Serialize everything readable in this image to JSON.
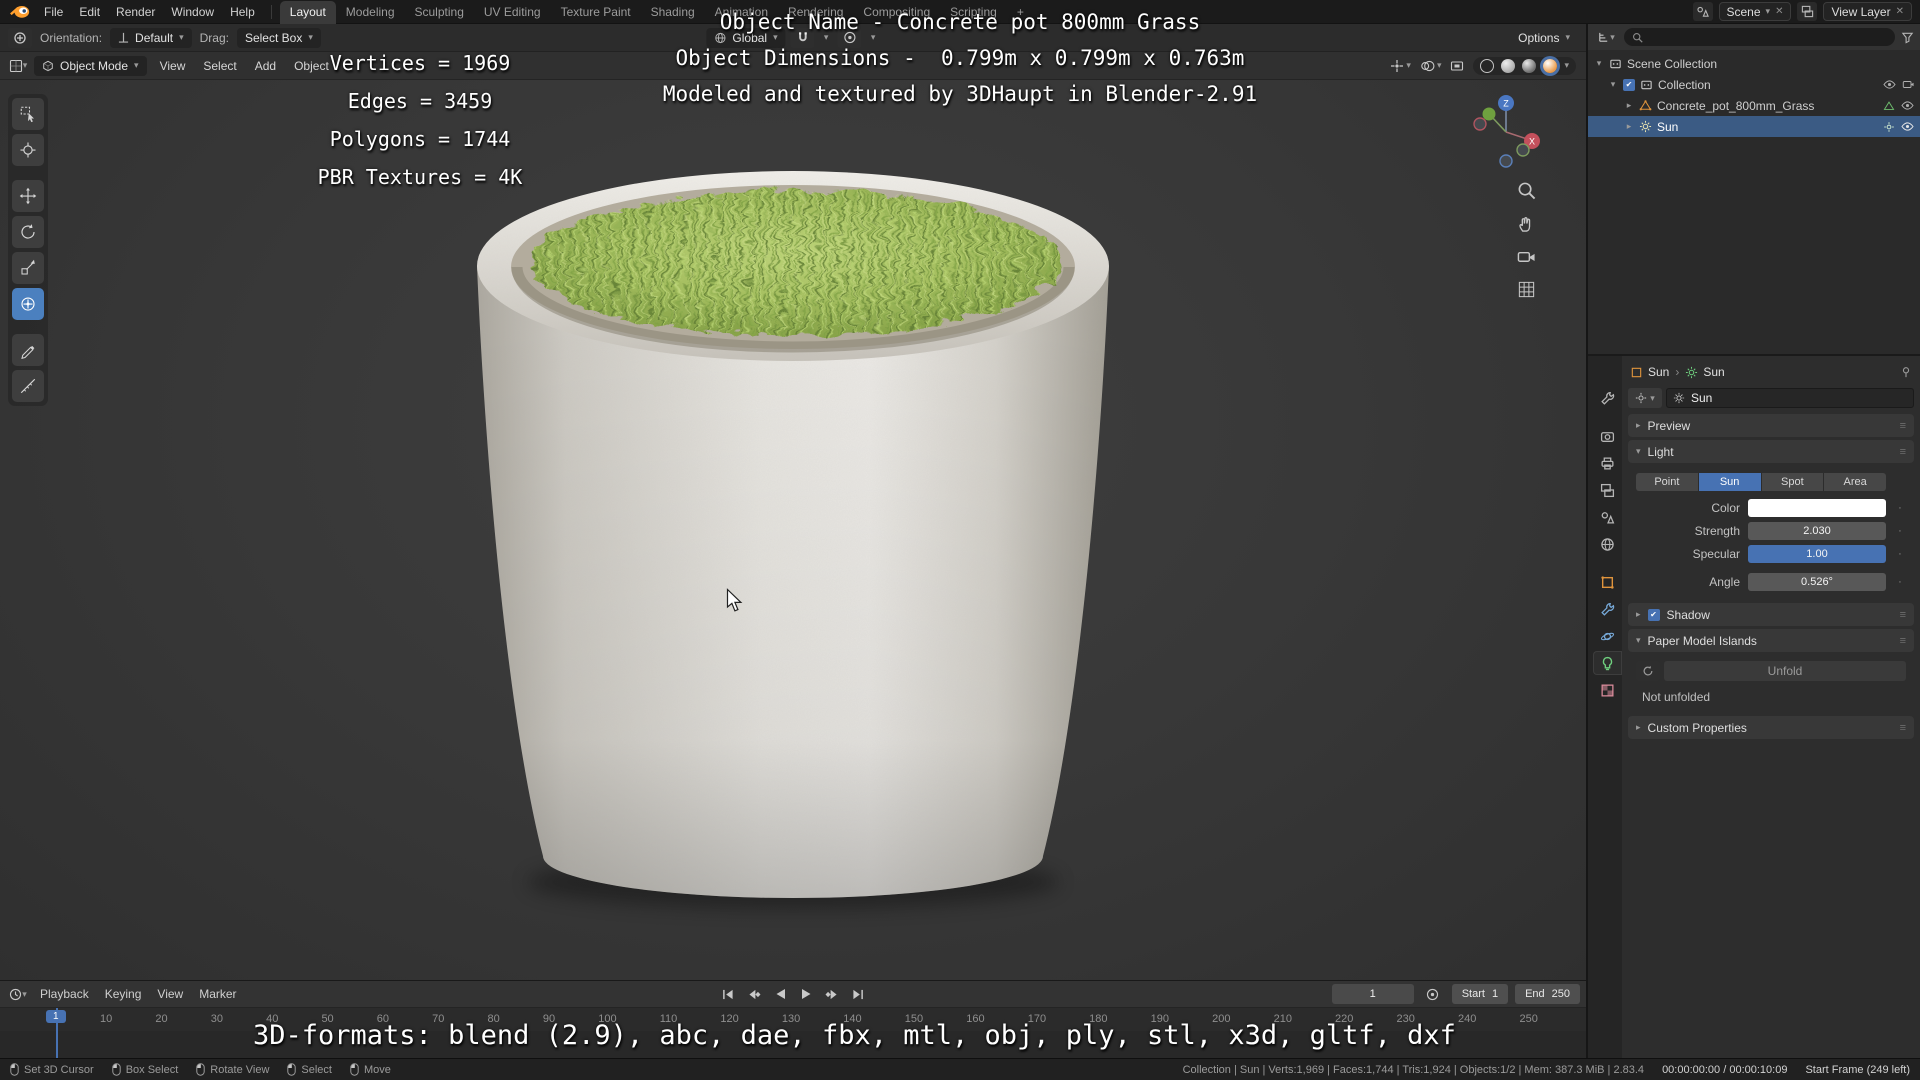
{
  "colors": {
    "accent": "#4772b3",
    "selection": "#3b5b84",
    "active_tool": "#4b80bf",
    "pot": "#e6e4df",
    "grass": "#9cb85a"
  },
  "icons": {
    "chevron_down": "▾",
    "chevron_right": "▸",
    "separator": "›",
    "close": "✕",
    "check": "✔",
    "grip": "≡",
    "dot": "·"
  },
  "topbar": {
    "menus": [
      "File",
      "Edit",
      "Render",
      "Window",
      "Help"
    ],
    "workspaces": [
      {
        "label": "Layout",
        "active": true
      },
      {
        "label": "Modeling"
      },
      {
        "label": "Sculpting"
      },
      {
        "label": "UV Editing"
      },
      {
        "label": "Texture Paint"
      },
      {
        "label": "Shading"
      },
      {
        "label": "Animation"
      },
      {
        "label": "Rendering"
      },
      {
        "label": "Compositing"
      },
      {
        "label": "Scripting"
      }
    ],
    "add_workspace": "+",
    "scene": "Scene",
    "view_layer": "View Layer"
  },
  "tool_settings": {
    "orientation_label": "Orientation:",
    "orientation": "Default",
    "drag_label": "Drag:",
    "drag": "Select Box",
    "transform_space": "Global",
    "options": "Options"
  },
  "viewport_header": {
    "mode": "Object Mode",
    "menus": [
      "View",
      "Select",
      "Add",
      "Object"
    ]
  },
  "viewport": {
    "title_lines": [
      "Object Name - Concrete pot 800mm Grass",
      "Object Dimensions -  0.799m x 0.799m x 0.763m",
      "Modeled and textured by 3DHaupt in Blender-2.91"
    ],
    "stats": [
      "Vertices = 1969",
      "Edges = 3459",
      "Polygons = 1744",
      "PBR Textures = 4K"
    ],
    "formats": "3D-formats: blend (2.9), abc, dae, fbx, mtl, obj, ply, stl, x3d, gltf, dxf",
    "gizmo": {
      "x": "X",
      "z": "Z"
    }
  },
  "outliner": {
    "scene_collection": "Scene Collection",
    "collection": "Collection",
    "mesh_object": "Concrete_pot_800mm_Grass",
    "light_object": "Sun"
  },
  "properties": {
    "breadcrumb_object": "Sun",
    "breadcrumb_data": "Sun",
    "name_value": "Sun",
    "panel_preview": "Preview",
    "panel_light": "Light",
    "panel_shadow": "Shadow",
    "panel_paper": "Paper Model Islands",
    "panel_custom": "Custom Properties",
    "light_types": [
      {
        "label": "Point"
      },
      {
        "label": "Sun",
        "active": true
      },
      {
        "label": "Spot"
      },
      {
        "label": "Area"
      }
    ],
    "color_label": "Color",
    "strength_label": "Strength",
    "strength_value": "2.030",
    "specular_label": "Specular",
    "specular_value": "1.00",
    "angle_label": "Angle",
    "angle_value": "0.526°",
    "unfold_label": "Unfold",
    "paper_status": "Not unfolded"
  },
  "timeline": {
    "menus": [
      "Playback",
      "Keying",
      "View",
      "Marker"
    ],
    "current_frame": "1",
    "playhead_label": "1",
    "start_label": "Start",
    "start_value": "1",
    "end_label": "End",
    "end_value": "250",
    "ticks": [
      "10",
      "20",
      "30",
      "40",
      "50",
      "60",
      "70",
      "80",
      "90",
      "100",
      "110",
      "120",
      "130",
      "140",
      "150",
      "160",
      "170",
      "180",
      "190",
      "200",
      "210",
      "220",
      "230",
      "240",
      "250"
    ]
  },
  "statusbar": {
    "hints": [
      {
        "label": "Set 3D Cursor"
      },
      {
        "label": "Box Select"
      },
      {
        "label": "Rotate View"
      },
      {
        "label": "Select"
      },
      {
        "label": "Move"
      }
    ],
    "stats": "Collection | Sun | Verts:1,969 | Faces:1,744 | Tris:1,924 | Objects:1/2 | Mem: 387.3 MiB | 2.83.4",
    "timecode": "00:00:00:00 / 00:00:10:09",
    "frame_status": "Start Frame (249 left)"
  }
}
